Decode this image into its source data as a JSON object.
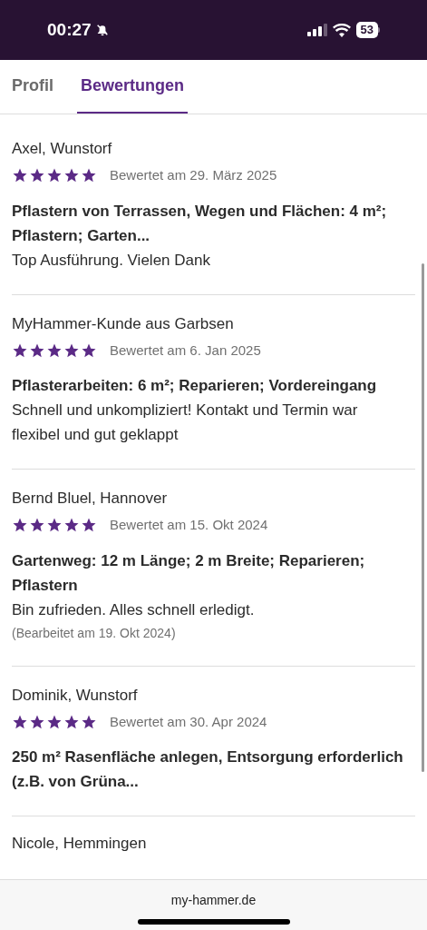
{
  "status_bar": {
    "time": "00:27",
    "battery": "53"
  },
  "tabs": [
    {
      "label": "Profil",
      "selected": false
    },
    {
      "label": "Bewertungen",
      "selected": true
    }
  ],
  "reviews": [
    {
      "author": "Axel, Wunstorf",
      "stars": 5,
      "date": "Bewertet am 29. März 2025",
      "title": "Pflastern von Terrassen, Wegen und Flächen: 4 m²; Pflastern; Garten...",
      "text": "Top Ausführung. Vielen Dank"
    },
    {
      "author": "MyHammer-Kunde aus Garbsen",
      "stars": 5,
      "date": "Bewertet am 6. Jan 2025",
      "title": "Pflasterarbeiten: 6 m²; Reparieren; Vordereingang",
      "text": "Schnell und unkompliziert! Kontakt und Termin war flexibel und gut geklappt"
    },
    {
      "author": "Bernd Bluel, Hannover",
      "stars": 5,
      "date": "Bewertet am 15. Okt 2024",
      "title": "Gartenweg: 12 m Länge; 2 m Breite; Reparieren; Pflastern",
      "text": "Bin zufrieden. Alles schnell erledigt.",
      "edited": "(Bearbeitet am 19. Okt 2024)"
    },
    {
      "author": "Dominik, Wunstorf",
      "stars": 5,
      "date": "Bewertet am 30. Apr 2024",
      "title": "250 m² Rasenfläche anlegen, Entsorgung erforderlich (z.B. von Grüna..."
    }
  ],
  "next_author": "Nicole, Hemmingen",
  "url_bar": {
    "address": "my-hammer.de"
  }
}
